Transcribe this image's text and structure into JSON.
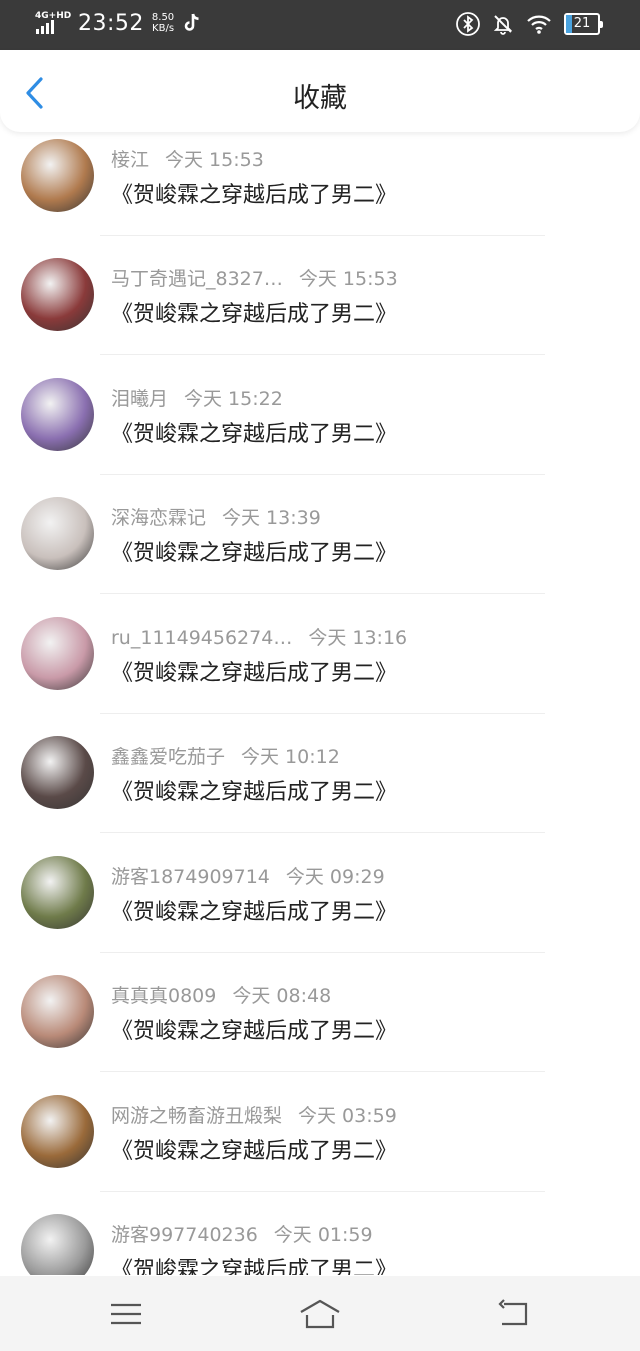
{
  "status_bar": {
    "network": "4G+HD",
    "time": "23:52",
    "speed_value": "8.50",
    "speed_unit": "KB/s",
    "battery": "21"
  },
  "header": {
    "title": "收藏",
    "back_icon": "chevron-left-icon",
    "accent": "#2f8de4"
  },
  "items": [
    {
      "user": "椄江",
      "time": "今天 15:53",
      "book": "《贺峻霖之穿越后成了男二》",
      "avatar": "#b07a4e"
    },
    {
      "user": "马丁奇遇记_8327…",
      "time": "今天 15:53",
      "book": "《贺峻霖之穿越后成了男二》",
      "avatar": "#8a3a3a"
    },
    {
      "user": "泪曦月",
      "time": "今天 15:22",
      "book": "《贺峻霖之穿越后成了男二》",
      "avatar": "#8a6fb0"
    },
    {
      "user": "深海恋霖记",
      "time": "今天 13:39",
      "book": "《贺峻霖之穿越后成了男二》",
      "avatar": "#c9c0bc"
    },
    {
      "user": "ru_11149456274…",
      "time": "今天 13:16",
      "book": "《贺峻霖之穿越后成了男二》",
      "avatar": "#c99aa8"
    },
    {
      "user": "鑫鑫爱吃茄子",
      "time": "今天 10:12",
      "book": "《贺峻霖之穿越后成了男二》",
      "avatar": "#5a4a48"
    },
    {
      "user": "游客1874909714",
      "time": "今天 09:29",
      "book": "《贺峻霖之穿越后成了男二》",
      "avatar": "#6f7b4a"
    },
    {
      "user": "真真真0809",
      "time": "今天 08:48",
      "book": "《贺峻霖之穿越后成了男二》",
      "avatar": "#b98a78"
    },
    {
      "user": "网游之畅畜游丑煅梨",
      "time": "今天 03:59",
      "book": "《贺峻霖之穿越后成了男二》",
      "avatar": "#9a6a3a"
    },
    {
      "user": "游客997740236",
      "time": "今天 01:59",
      "book": "《贺峻霖之穿越后成了男二》",
      "avatar": "#9a9a9a"
    }
  ],
  "nav_bar": {
    "menu_icon": "menu-icon",
    "home_icon": "home-icon",
    "back_icon": "back-arrow-icon"
  }
}
